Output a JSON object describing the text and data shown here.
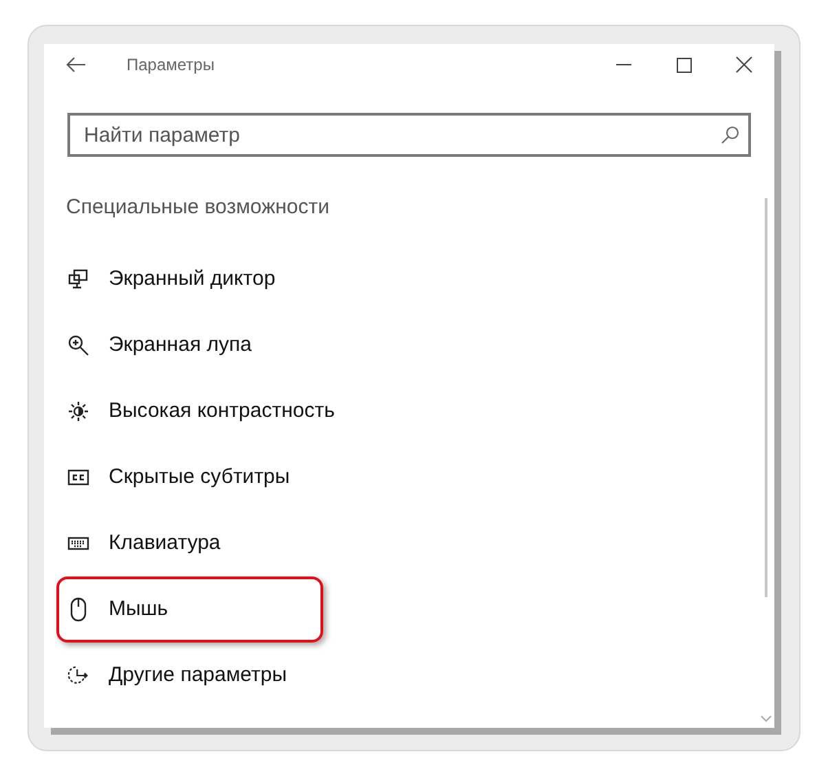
{
  "window": {
    "title": "Параметры"
  },
  "search": {
    "placeholder": "Найти параметр"
  },
  "section": {
    "title": "Специальные возможности"
  },
  "items": [
    {
      "label": "Экранный диктор",
      "highlighted": false
    },
    {
      "label": "Экранная лупа",
      "highlighted": false
    },
    {
      "label": "Высокая контрастность",
      "highlighted": false
    },
    {
      "label": "Скрытые субтитры",
      "highlighted": false
    },
    {
      "label": "Клавиатура",
      "highlighted": false
    },
    {
      "label": "Мышь",
      "highlighted": true
    },
    {
      "label": "Другие параметры",
      "highlighted": false
    }
  ]
}
